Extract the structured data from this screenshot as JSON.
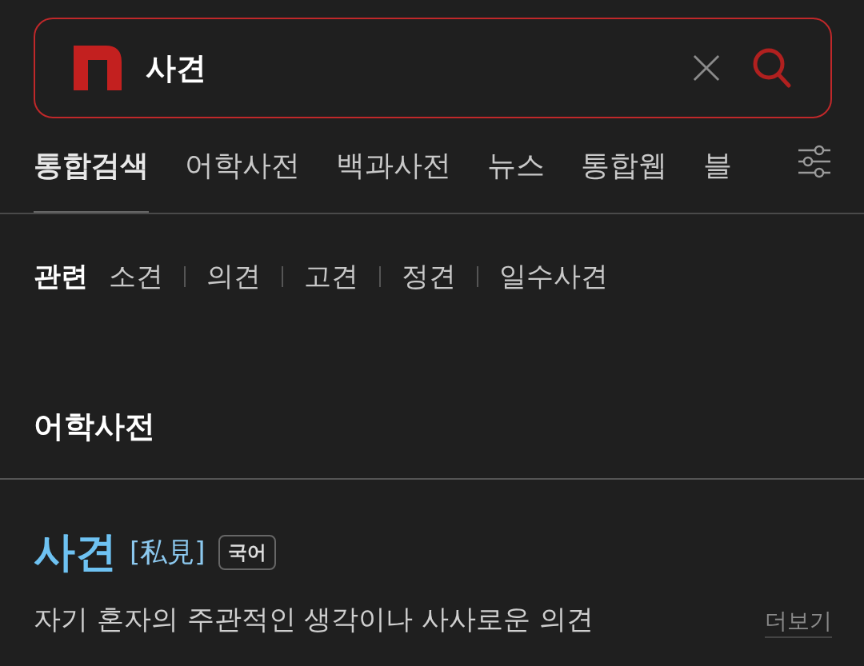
{
  "search": {
    "value": "사견"
  },
  "tabs": [
    {
      "label": "통합검색",
      "selected": true
    },
    {
      "label": "어학사전",
      "selected": false
    },
    {
      "label": "백과사전",
      "selected": false
    },
    {
      "label": "뉴스",
      "selected": false
    },
    {
      "label": "통합웹",
      "selected": false
    },
    {
      "label": "블",
      "selected": false
    }
  ],
  "related": {
    "label": "관련",
    "items": [
      "소견",
      "의견",
      "고견",
      "정견",
      "일수사견"
    ]
  },
  "section": {
    "title": "어학사전"
  },
  "entry": {
    "word": "사견",
    "hanja": "[私見]",
    "badge": "국어",
    "definition": "자기 혼자의 주관적인 생각이나 사사로운 의견",
    "more": "더보기"
  }
}
